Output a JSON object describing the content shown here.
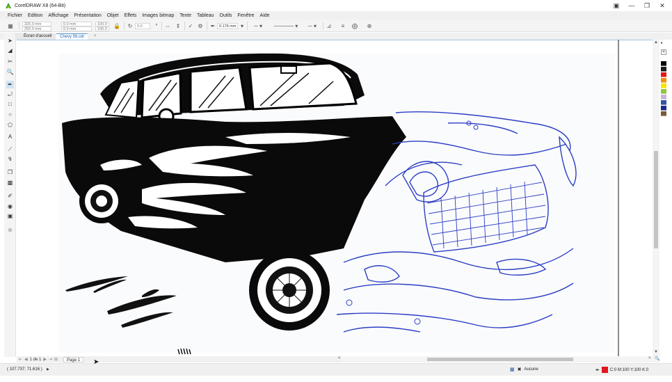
{
  "app": {
    "title": "CorelDRAW X8 (64-Bit)",
    "logo_color": "#3a9d2f"
  },
  "window_controls": [
    "restore-icon",
    "minimize-icon",
    "maximize-icon",
    "close-icon"
  ],
  "menu": [
    "Fichier",
    "Edition",
    "Affichage",
    "Présentation",
    "Objet",
    "Effets",
    "Images bitmap",
    "Texte",
    "Tableau",
    "Outils",
    "Fenêtre",
    "Aide"
  ],
  "propbar": {
    "width": "325.0 mm",
    "height": "250.0 mm",
    "x": "0.0 mm",
    "y": "0.0 mm",
    "scale_x": "100.0",
    "scale_y": "100.0",
    "rotation": "0.0",
    "outline_width": "0.176 mm"
  },
  "tabs": {
    "home": "Écran d'accueil",
    "document": "Chevy 56.cdr",
    "add": "+"
  },
  "page_nav": {
    "count": "1 de 1",
    "page_tab": "Page 1"
  },
  "status": {
    "coords": "( 107.737; 71.616 )",
    "fill_label": "Aucune",
    "outline_color": "C:0 M:100 Y:100 K:0",
    "outline_swatch": "#e2161b"
  },
  "palette": [
    "#ffffff",
    "#000000",
    "#1a1a1a",
    "#e2161b",
    "#f28c0f",
    "#f7e300",
    "#8ec63f",
    "#c8b3d9",
    "#3054a6",
    "#1c2b8a",
    "#7a5a3a"
  ]
}
